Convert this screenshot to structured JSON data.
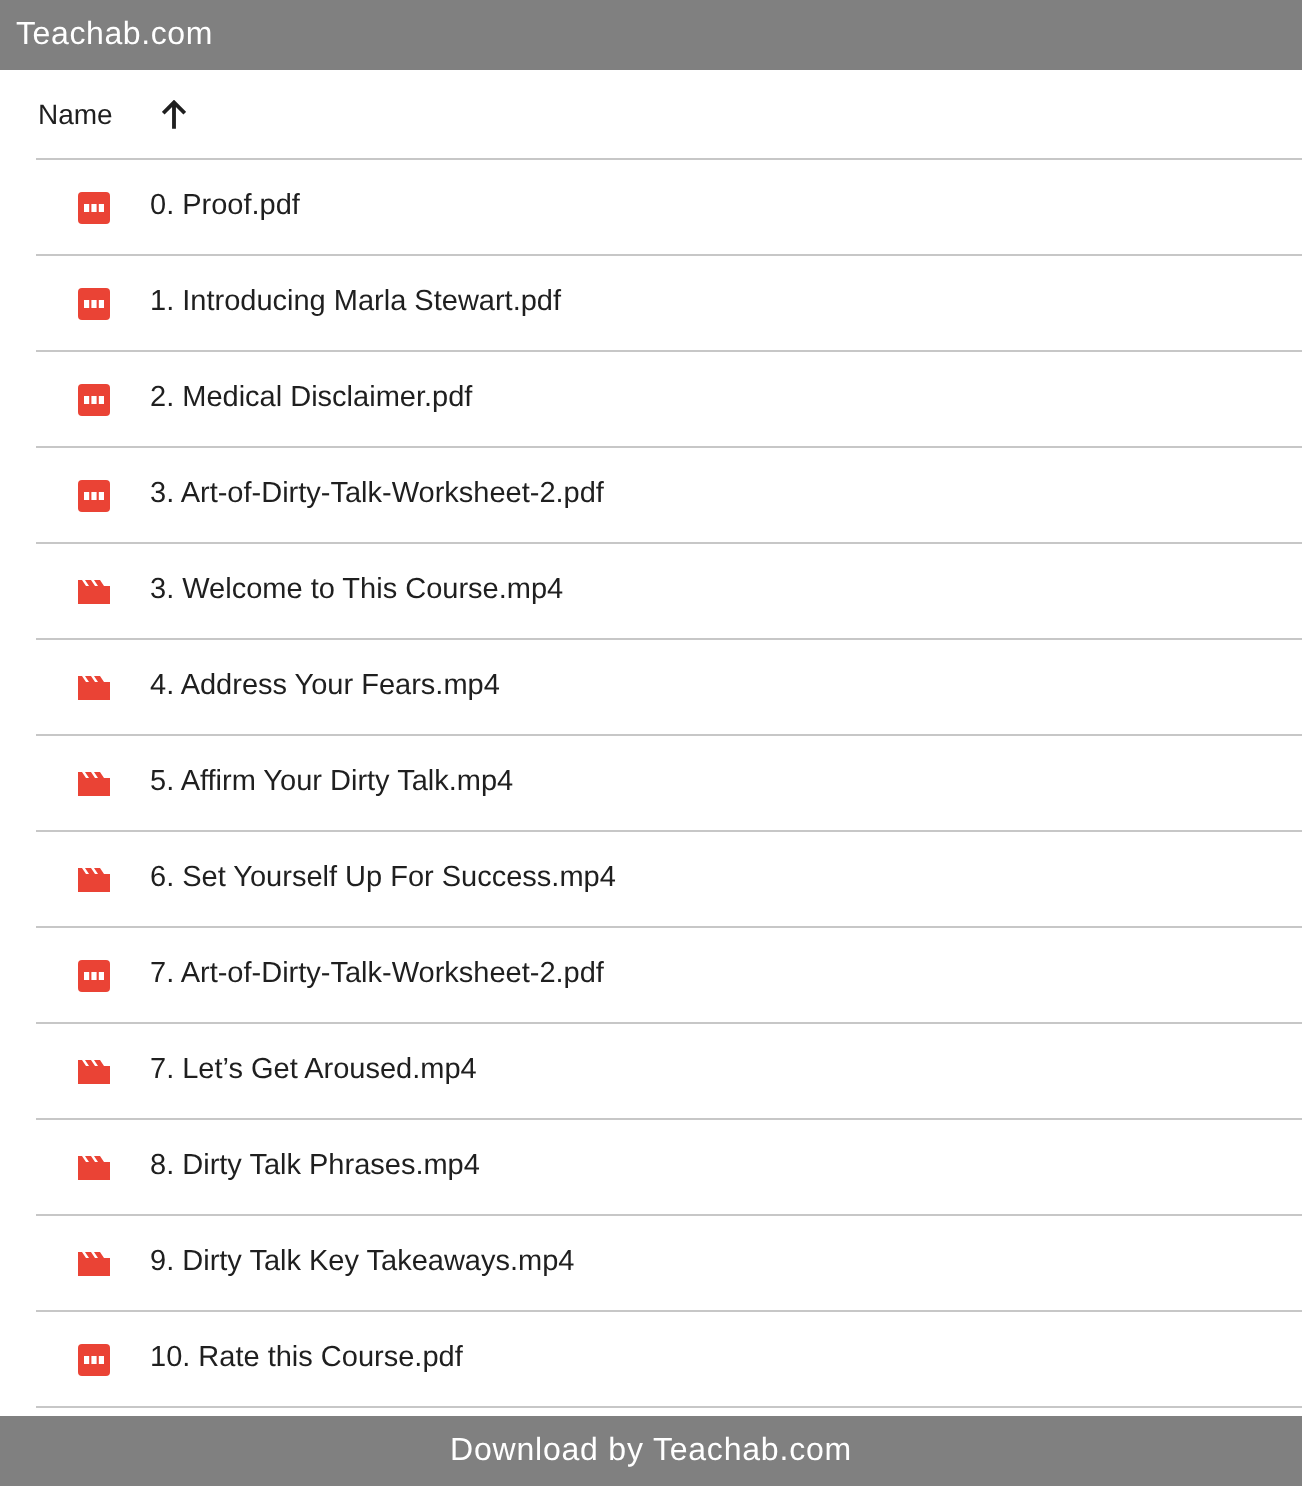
{
  "header": {
    "title": "Teachab.com"
  },
  "table": {
    "columns": [
      {
        "label": "Name",
        "sort_ascending": true
      }
    ],
    "rows": [
      {
        "name": "0. Proof.pdf",
        "kind": "pdf"
      },
      {
        "name": "1. Introducing Marla Stewart.pdf",
        "kind": "pdf"
      },
      {
        "name": "2. Medical Disclaimer.pdf",
        "kind": "pdf"
      },
      {
        "name": "3. Art-of-Dirty-Talk-Worksheet-2.pdf",
        "kind": "pdf"
      },
      {
        "name": "3. Welcome to This Course.mp4",
        "kind": "video"
      },
      {
        "name": "4. Address Your Fears.mp4",
        "kind": "video"
      },
      {
        "name": "5. Affirm Your Dirty Talk.mp4",
        "kind": "video"
      },
      {
        "name": "6. Set Yourself Up For Success.mp4",
        "kind": "video"
      },
      {
        "name": "7. Art-of-Dirty-Talk-Worksheet-2.pdf",
        "kind": "pdf"
      },
      {
        "name": "7. Let’s Get Aroused.mp4",
        "kind": "video"
      },
      {
        "name": "8. Dirty Talk Phrases.mp4",
        "kind": "video"
      },
      {
        "name": "9. Dirty Talk Key Takeaways.mp4",
        "kind": "video"
      },
      {
        "name": "10. Rate this Course.pdf",
        "kind": "pdf"
      }
    ]
  },
  "footer": {
    "text": "Download by Teachab.com"
  }
}
